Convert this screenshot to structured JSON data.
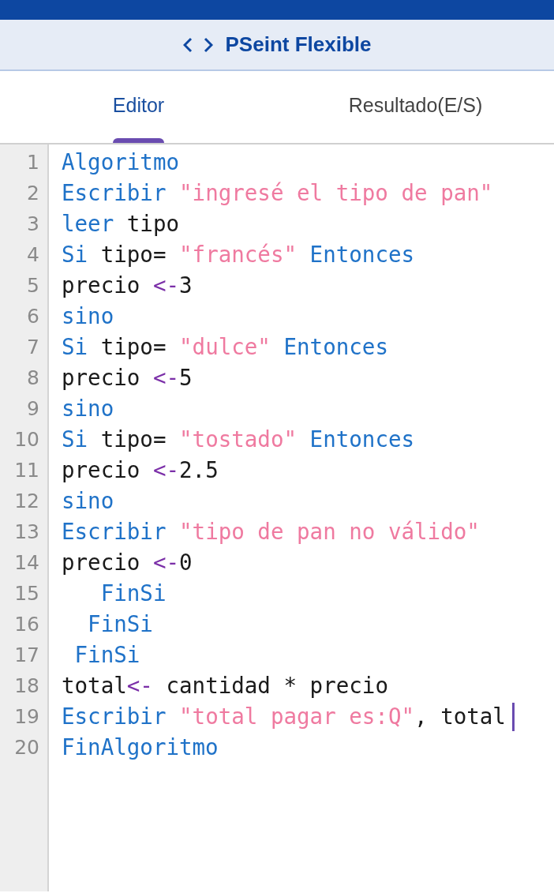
{
  "app_bar": {
    "title": "PSeint Flexible"
  },
  "tabs": [
    {
      "label": "Editor",
      "selected": true
    },
    {
      "label": "Resultado(E/S)",
      "selected": false
    }
  ],
  "editor": {
    "lines": [
      {
        "number": "1",
        "cursor": false,
        "tokens": [
          {
            "kind": "keyword",
            "text": "Algoritmo"
          }
        ]
      },
      {
        "number": "2",
        "cursor": false,
        "tokens": [
          {
            "kind": "keyword",
            "text": "Escribir "
          },
          {
            "kind": "string",
            "text": "\"ingresé el tipo de pan\""
          }
        ]
      },
      {
        "number": "3",
        "cursor": false,
        "tokens": [
          {
            "kind": "keyword",
            "text": "leer"
          },
          {
            "kind": "plain",
            "text": " tipo"
          }
        ]
      },
      {
        "number": "4",
        "cursor": false,
        "tokens": [
          {
            "kind": "keyword",
            "text": "Si"
          },
          {
            "kind": "plain",
            "text": " tipo= "
          },
          {
            "kind": "string",
            "text": "\"francés\""
          },
          {
            "kind": "keyword",
            "text": " Entonces"
          }
        ]
      },
      {
        "number": "5",
        "cursor": false,
        "tokens": [
          {
            "kind": "plain",
            "text": "precio "
          },
          {
            "kind": "operator",
            "text": "<-"
          },
          {
            "kind": "plain",
            "text": "3"
          }
        ]
      },
      {
        "number": "6",
        "cursor": false,
        "tokens": [
          {
            "kind": "keyword",
            "text": "sino"
          }
        ]
      },
      {
        "number": "7",
        "cursor": false,
        "tokens": [
          {
            "kind": "keyword",
            "text": "Si"
          },
          {
            "kind": "plain",
            "text": " tipo= "
          },
          {
            "kind": "string",
            "text": "\"dulce\""
          },
          {
            "kind": "keyword",
            "text": " Entonces"
          }
        ]
      },
      {
        "number": "8",
        "cursor": false,
        "tokens": [
          {
            "kind": "plain",
            "text": "precio "
          },
          {
            "kind": "operator",
            "text": "<-"
          },
          {
            "kind": "plain",
            "text": "5"
          }
        ]
      },
      {
        "number": "9",
        "cursor": false,
        "tokens": [
          {
            "kind": "keyword",
            "text": "sino"
          }
        ]
      },
      {
        "number": "10",
        "cursor": false,
        "tokens": [
          {
            "kind": "keyword",
            "text": "Si"
          },
          {
            "kind": "plain",
            "text": " tipo= "
          },
          {
            "kind": "string",
            "text": "\"tostado\""
          },
          {
            "kind": "keyword",
            "text": " Entonces"
          }
        ]
      },
      {
        "number": "11",
        "cursor": false,
        "tokens": [
          {
            "kind": "plain",
            "text": "precio "
          },
          {
            "kind": "operator",
            "text": "<-"
          },
          {
            "kind": "plain",
            "text": "2.5"
          }
        ]
      },
      {
        "number": "12",
        "cursor": false,
        "tokens": [
          {
            "kind": "keyword",
            "text": "sino"
          }
        ]
      },
      {
        "number": "13",
        "cursor": false,
        "tokens": [
          {
            "kind": "keyword",
            "text": "Escribir "
          },
          {
            "kind": "string",
            "text": "\"tipo de pan no válido\""
          }
        ]
      },
      {
        "number": "14",
        "cursor": false,
        "tokens": [
          {
            "kind": "plain",
            "text": "precio "
          },
          {
            "kind": "operator",
            "text": "<-"
          },
          {
            "kind": "plain",
            "text": "0"
          }
        ]
      },
      {
        "number": "15",
        "cursor": false,
        "tokens": [
          {
            "kind": "keyword",
            "text": "   FinSi"
          }
        ]
      },
      {
        "number": "16",
        "cursor": false,
        "tokens": [
          {
            "kind": "keyword",
            "text": "  FinSi"
          }
        ]
      },
      {
        "number": "17",
        "cursor": false,
        "tokens": [
          {
            "kind": "keyword",
            "text": " FinSi"
          }
        ]
      },
      {
        "number": "18",
        "cursor": false,
        "tokens": [
          {
            "kind": "plain",
            "text": "total"
          },
          {
            "kind": "operator",
            "text": "<-"
          },
          {
            "kind": "plain",
            "text": " cantidad * precio"
          }
        ]
      },
      {
        "number": "19",
        "cursor": true,
        "tokens": [
          {
            "kind": "keyword",
            "text": "Escribir "
          },
          {
            "kind": "string",
            "text": "\"total pagar es:Q\""
          },
          {
            "kind": "plain",
            "text": ", total"
          }
        ]
      },
      {
        "number": "20",
        "cursor": false,
        "tokens": [
          {
            "kind": "keyword",
            "text": "FinAlgoritmo"
          }
        ]
      }
    ]
  }
}
